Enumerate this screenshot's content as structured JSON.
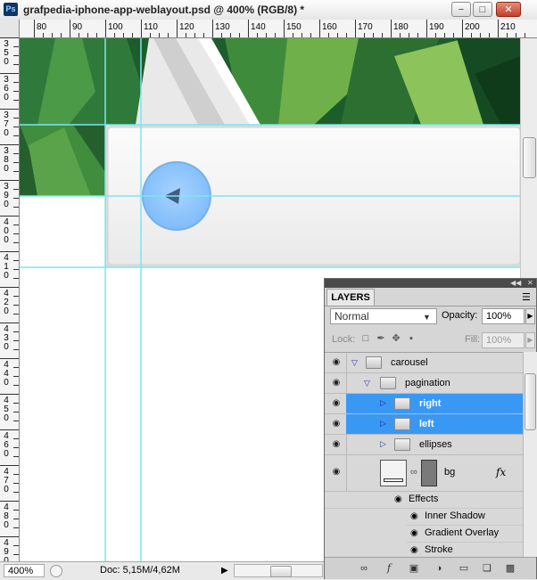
{
  "window": {
    "app_icon": "Ps",
    "title": "grafpedia-iphone-app-weblayout.psd @ 400% (RGB/8) *",
    "min_glyph": "−",
    "max_glyph": "□",
    "close_glyph": "✕"
  },
  "ruler_top": [
    "80",
    "90",
    "100",
    "110",
    "120",
    "130",
    "140",
    "150",
    "160",
    "170",
    "180",
    "190",
    "200",
    "210"
  ],
  "ruler_left": [
    "350",
    "360",
    "370",
    "380",
    "390",
    "400",
    "410",
    "420",
    "430",
    "440",
    "450",
    "460",
    "470",
    "480",
    "490"
  ],
  "status": {
    "zoom": "400%",
    "doc": "Doc: 5,15M/4,62M"
  },
  "colors": {
    "accent_selection": "#3a98f5",
    "guide": "#7de6f0",
    "pagination_button": "#8cc3ff"
  },
  "layers_panel": {
    "tab_label": "LAYERS",
    "blend_mode": "Normal",
    "opacity_label": "Opacity:",
    "opacity_value": "100%",
    "lock_label": "Lock:",
    "fill_label": "Fill:",
    "fill_value": "100%",
    "layers": [
      {
        "name": "carousel",
        "kind": "group",
        "expanded": true,
        "selected": false,
        "level": 0
      },
      {
        "name": "pagination",
        "kind": "group",
        "expanded": true,
        "selected": false,
        "level": 1
      },
      {
        "name": "right",
        "kind": "group",
        "expanded": false,
        "selected": true,
        "level": 2
      },
      {
        "name": "left",
        "kind": "group",
        "expanded": false,
        "selected": true,
        "level": 2
      },
      {
        "name": "ellipses",
        "kind": "group",
        "expanded": false,
        "selected": false,
        "level": 2
      },
      {
        "name": "bg",
        "kind": "layer",
        "has_fx": true,
        "fx_label": "fx",
        "selected": false,
        "level": 2
      }
    ],
    "effects_label": "Effects",
    "effects": [
      "Inner Shadow",
      "Gradient Overlay",
      "Stroke"
    ]
  }
}
